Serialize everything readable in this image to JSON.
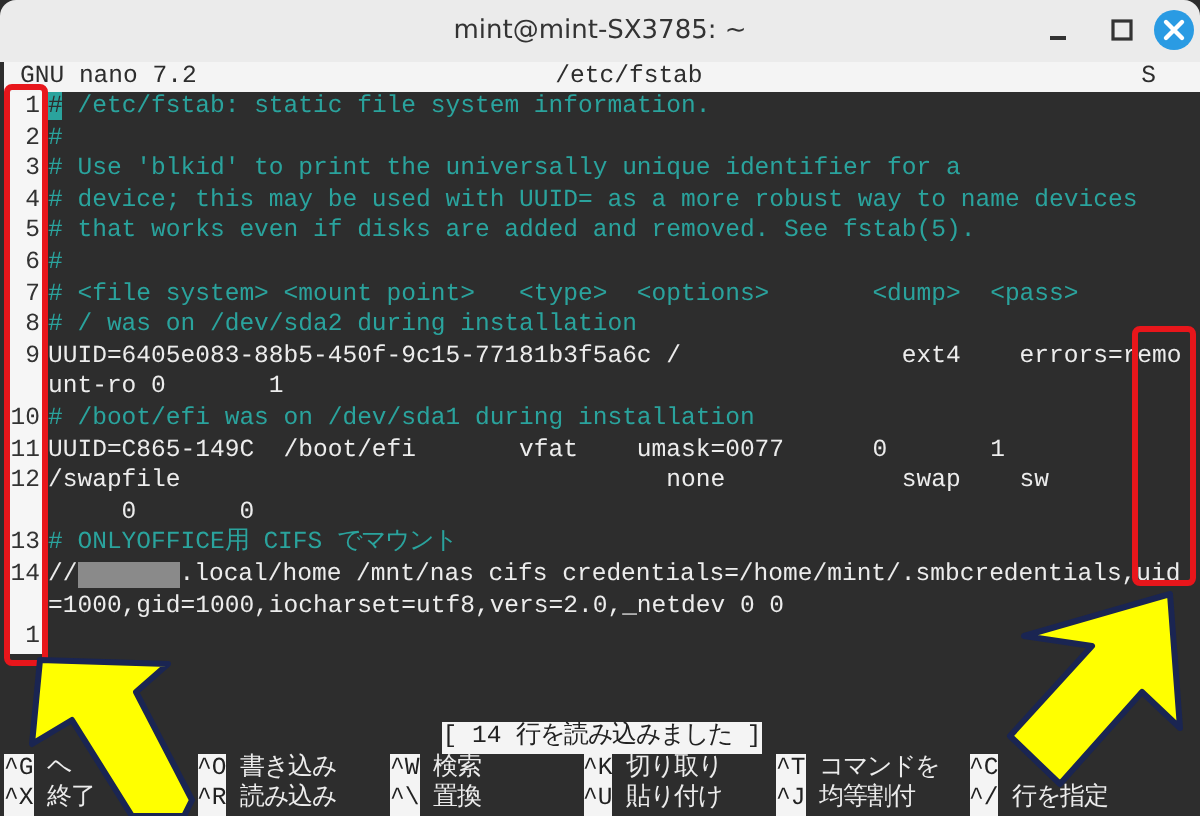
{
  "window": {
    "title": "mint@mint-SX3785: ~"
  },
  "header": {
    "left": "GNU nano 7.2",
    "center": "/etc/fstab",
    "right": "S"
  },
  "lines": [
    {
      "number": "1",
      "kind": "comment",
      "cursor": true,
      "text": "# /etc/fstab: static file system information."
    },
    {
      "number": "2",
      "kind": "comment",
      "text": "#"
    },
    {
      "number": "3",
      "kind": "comment",
      "text": "# Use 'blkid' to print the universally unique identifier for a"
    },
    {
      "number": "4",
      "kind": "comment",
      "text": "# device; this may be used with UUID= as a more robust way to name devices"
    },
    {
      "number": "5",
      "kind": "comment",
      "text": "# that works even if disks are added and removed. See fstab(5)."
    },
    {
      "number": "6",
      "kind": "comment",
      "text": "#"
    },
    {
      "number": "7",
      "kind": "comment",
      "text": "# <file system> <mount point>   <type>  <options>       <dump>  <pass>"
    },
    {
      "number": "8",
      "kind": "comment",
      "text": "# / was on /dev/sda2 during installation"
    },
    {
      "number": "9",
      "kind": "code",
      "text": "UUID=6405e083-88b5-450f-9c15-77181b3f5a6c /               ext4    errors=remo"
    },
    {
      "kind": "code",
      "text": "unt-ro 0       1"
    },
    {
      "number": "10",
      "kind": "comment",
      "text": "# /boot/efi was on /dev/sda1 during installation"
    },
    {
      "number": "11",
      "kind": "code",
      "text": "UUID=C865-149C  /boot/efi       vfat    umask=0077      0       1"
    },
    {
      "number": "12",
      "kind": "code",
      "text": "/swapfile                                 none            swap    sw"
    },
    {
      "kind": "code",
      "text": "     0       0"
    },
    {
      "number": "13",
      "kind": "comment",
      "text": "# ONLYOFFICE用 CIFS でマウント"
    },
    {
      "number": "14",
      "kind": "code",
      "prefix": "//",
      "redacted": true,
      "text": ".local/home /mnt/nas cifs credentials=/home/mint/.smbcredentials,uid"
    },
    {
      "kind": "code",
      "text": "=1000,gid=1000,iocharset=utf8,vers=2.0,_netdev 0 0"
    },
    {
      "number": "1",
      "kind": "code"
    }
  ],
  "status": "[ 14 行を読み込みました ]",
  "shortcut_rows": [
    {
      "items": [
        {
          "key": "^G",
          "label": "ヘ"
        },
        {
          "key": "^O",
          "label": "書き込み"
        },
        {
          "key": "^W",
          "label": "検索"
        },
        {
          "key": "^K",
          "label": "切り取り"
        },
        {
          "key": "^T",
          "label": "コマンドを"
        },
        {
          "key": "^C"
        }
      ]
    },
    {
      "items": [
        {
          "key": "^X",
          "label": "終了"
        },
        {
          "key": "^R",
          "label": "読み込み"
        },
        {
          "key": "^\\",
          "label": "置換"
        },
        {
          "key": "^U",
          "label": "貼り付け"
        },
        {
          "key": "^J",
          "label": "均等割付"
        },
        {
          "key": "^/",
          "label": "行を指定"
        }
      ]
    }
  ]
}
